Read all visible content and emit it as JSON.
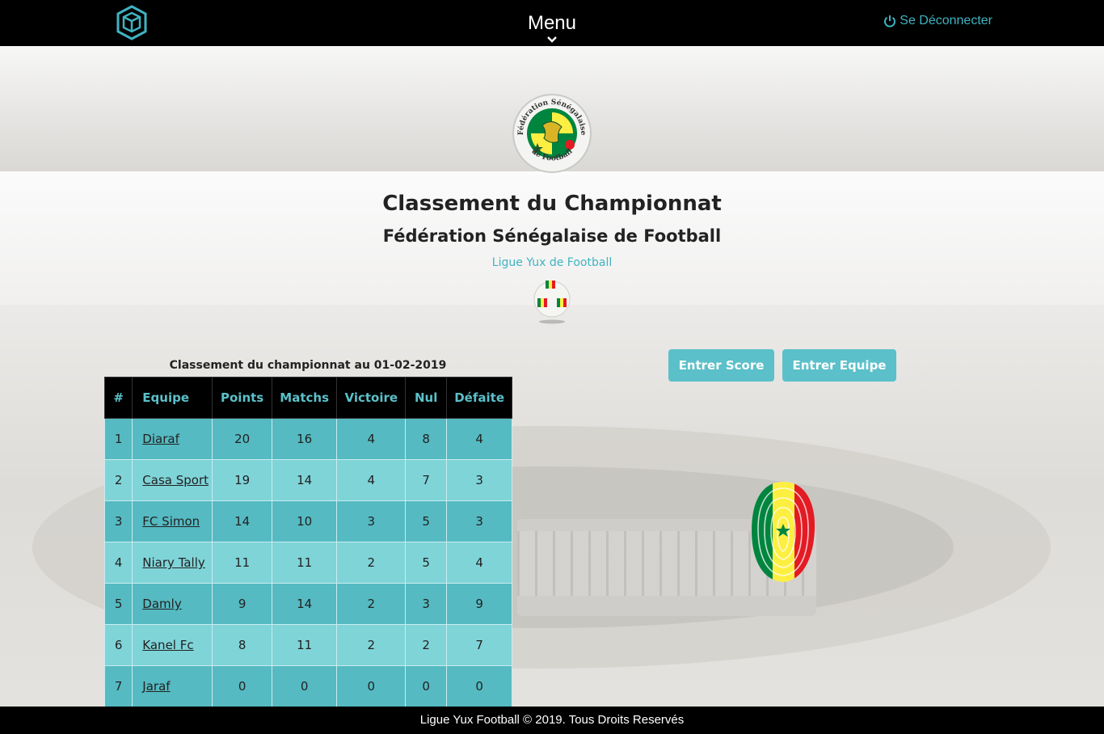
{
  "topbar": {
    "menu_label": "Menu",
    "logout_label": "Se Déconnecter",
    "accent_color": "#3fb3c2"
  },
  "header": {
    "title": "Classement du Championnat",
    "subtitle": "Fédération Sénégalaise de Football",
    "league": "Ligue Yux de Football",
    "federation_logo_text_top": "Fédération Sénégalaise",
    "federation_logo_text_bottom": "de Football"
  },
  "actions": {
    "enter_score": "Entrer Score",
    "enter_team": "Entrer Equipe"
  },
  "standings": {
    "caption": "Classement du championnat au 01-02-2019",
    "columns": [
      "#",
      "Equipe",
      "Points",
      "Matchs",
      "Victoire",
      "Nul",
      "Défaite"
    ],
    "rows": [
      {
        "rank": "1",
        "team": "Diaraf",
        "points": "20",
        "matches": "16",
        "wins": "4",
        "draws": "8",
        "losses": "4"
      },
      {
        "rank": "2",
        "team": "Casa Sport",
        "points": "19",
        "matches": "14",
        "wins": "4",
        "draws": "7",
        "losses": "3"
      },
      {
        "rank": "3",
        "team": "FC Simon",
        "points": "14",
        "matches": "10",
        "wins": "3",
        "draws": "5",
        "losses": "3"
      },
      {
        "rank": "4",
        "team": "Niary Tally",
        "points": "11",
        "matches": "11",
        "wins": "2",
        "draws": "5",
        "losses": "4"
      },
      {
        "rank": "5",
        "team": "Damly",
        "points": "9",
        "matches": "14",
        "wins": "2",
        "draws": "3",
        "losses": "9"
      },
      {
        "rank": "6",
        "team": "Kanel Fc",
        "points": "8",
        "matches": "11",
        "wins": "2",
        "draws": "2",
        "losses": "7"
      },
      {
        "rank": "7",
        "team": "Jaraf",
        "points": "0",
        "matches": "0",
        "wins": "0",
        "draws": "0",
        "losses": "0"
      }
    ]
  },
  "footer": {
    "text": "Ligue Yux Football © 2019. Tous Droits Reservés"
  },
  "colors": {
    "row_dark": "#55bac2",
    "row_light": "#7fd4d8",
    "button": "#5bc0c9",
    "senegal_green": "#00853f",
    "senegal_yellow": "#fdef42",
    "senegal_red": "#e31b23"
  }
}
